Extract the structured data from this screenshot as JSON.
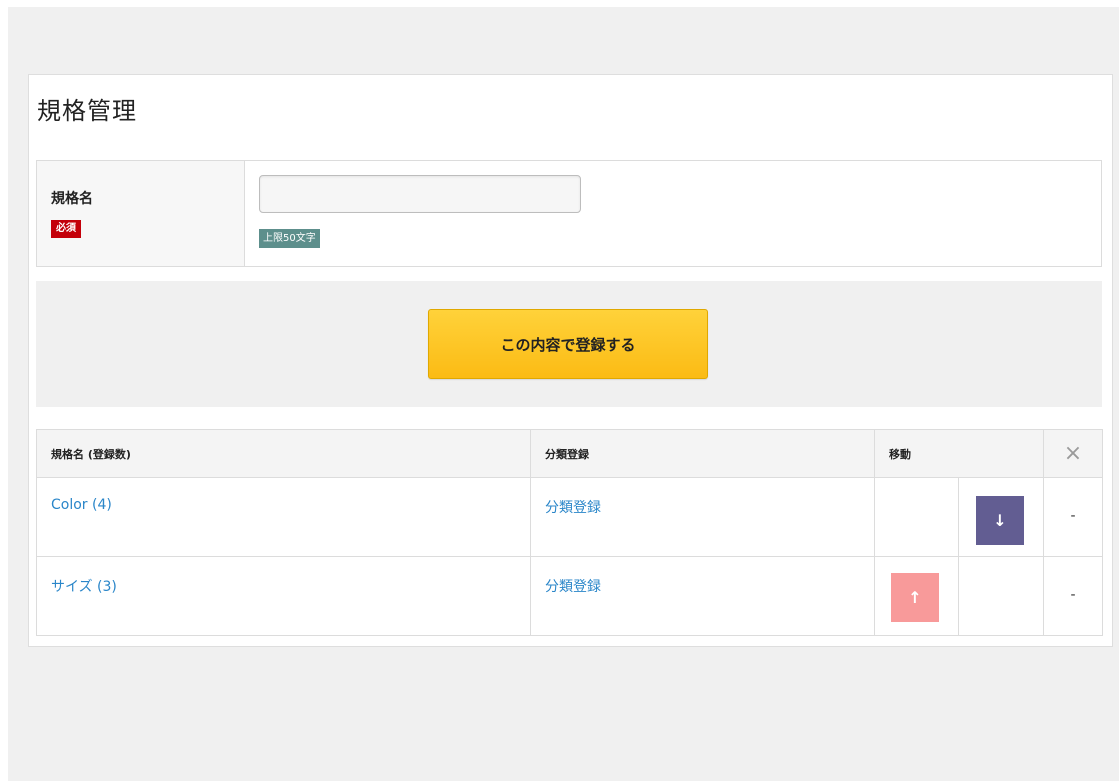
{
  "page": {
    "title": "規格管理"
  },
  "form": {
    "label": "規格名",
    "required_badge": "必須",
    "input_value": "",
    "input_placeholder": "",
    "limit_badge": "上限50文字"
  },
  "submit": {
    "label": "この内容で登録する"
  },
  "table": {
    "headers": {
      "name": "規格名 (登録数)",
      "category": "分類登録",
      "move": "移動",
      "close": "×"
    },
    "rows": [
      {
        "name": "Color (4)",
        "category_link": "分類登録",
        "move_up": "",
        "move_down": "↓",
        "delete": "-"
      },
      {
        "name": "サイズ (3)",
        "category_link": "分類登録",
        "move_up": "↑",
        "move_down": "",
        "delete": "-"
      }
    ]
  },
  "colors": {
    "required_badge": "#c4000a",
    "limit_badge": "#5d8f8c",
    "submit_button": "#fbbb14",
    "link": "#2a86c9",
    "move_down": "#625d92",
    "move_up": "#f89a9a"
  }
}
